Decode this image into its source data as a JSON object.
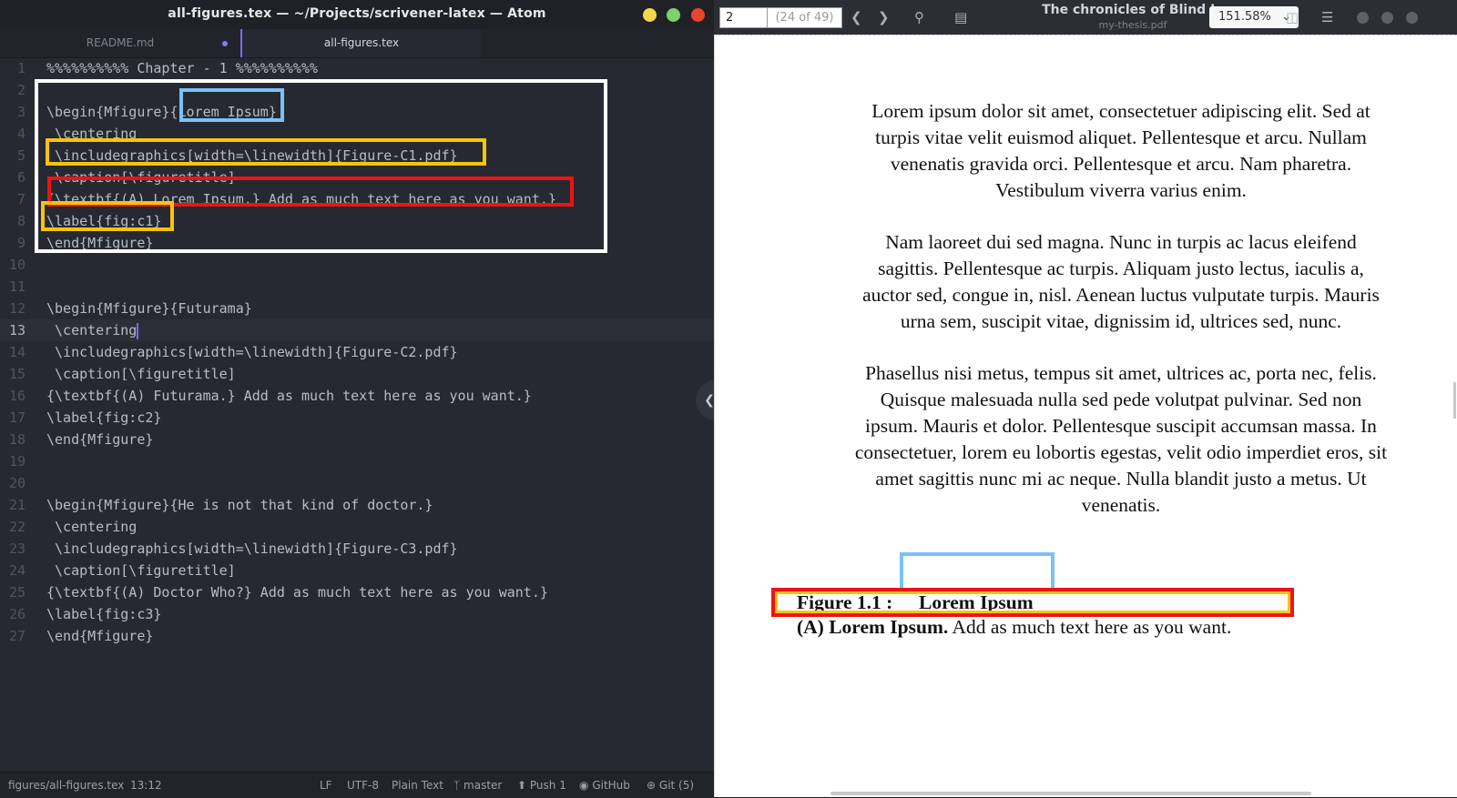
{
  "atom": {
    "window_title": "all-figures.tex — ~/Projects/scrivener-latex — Atom",
    "tabs": [
      {
        "label": "README.md",
        "modified": true
      },
      {
        "label": "all-figures.tex",
        "active": true
      }
    ],
    "lines": [
      "%%%%%%%%%% Chapter - 1 %%%%%%%%%%",
      "",
      "\\begin{Mfigure}{Lorem Ipsum}",
      " \\centering",
      " \\includegraphics[width=\\linewidth]{Figure-C1.pdf}",
      " \\caption[\\figuretitle]",
      "{\\textbf{(A) Lorem Ipsum.} Add as much text here as you want.}",
      "\\label{fig:c1}",
      "\\end{Mfigure}",
      "",
      "",
      "\\begin{Mfigure}{Futurama}",
      " \\centering",
      " \\includegraphics[width=\\linewidth]{Figure-C2.pdf}",
      " \\caption[\\figuretitle]",
      "{\\textbf{(A) Futurama.} Add as much text here as you want.}",
      "\\label{fig:c2}",
      "\\end{Mfigure}",
      "",
      "",
      "\\begin{Mfigure}{He is not that kind of doctor.}",
      " \\centering",
      " \\includegraphics[width=\\linewidth]{Figure-C3.pdf}",
      " \\caption[\\figuretitle]",
      "{\\textbf{(A) Doctor Who?} Add as much text here as you want.}",
      "\\label{fig:c3}",
      "\\end{Mfigure}"
    ],
    "cursor_line": 13,
    "status": {
      "file_path": "figures/all-figures.tex",
      "cursor_pos": "13:12",
      "line_ending": "LF",
      "encoding": "UTF-8",
      "grammar": "Plain Text",
      "branch": "master",
      "push": "Push 1",
      "github": "GitHub",
      "git": "Git (5)"
    }
  },
  "pdf": {
    "page_number": "2",
    "page_count": "(24 of 49)",
    "doc_title": "The chronicles of Blind Io",
    "doc_file": "my-thesis.pdf",
    "zoom": "151.58%",
    "paragraphs": [
      "Lorem ipsum dolor sit amet, consectetuer adipiscing elit. Sed at turpis vitae velit euismod aliquet. Pellentesque et arcu. Nullam venenatis gravida orci. Pellentesque et arcu. Nam pharetra. Vestibulum viverra varius enim.",
      "Nam laoreet dui sed magna. Nunc in turpis ac lacus eleifend sagittis. Pellentesque ac turpis. Aliquam justo lectus, iaculis a, auctor sed, congue in, nisl. Aenean luctus vulputate turpis. Mauris urna sem, suscipit vitae, dignissim id, ultrices sed, nunc.",
      "Phasellus nisi metus, tempus sit amet, ultrices ac, porta nec, felis. Quisque malesuada nulla sed pede volutpat pulvinar. Sed non ipsum. Mauris et dolor. Pellentesque suscipit accumsan massa. In consectetuer, lorem eu lobortis egestas, velit odio imperdiet eros, sit amet sagittis nunc mi ac neque. Nulla blandit justo a metus. Ut venenatis."
    ],
    "figure": {
      "label": "Figure 1.1 :",
      "title": "Lorem Ipsum",
      "caption_bold": "(A) Lorem Ipsum.",
      "caption_text": " Add as much text here as you want."
    }
  },
  "colors": {
    "highlight_white": "#ffffff",
    "highlight_blue": "#7ac2f5",
    "highlight_yellow": "#f6c40f",
    "highlight_red": "#ee1313",
    "accent": "#7e6bf0"
  }
}
